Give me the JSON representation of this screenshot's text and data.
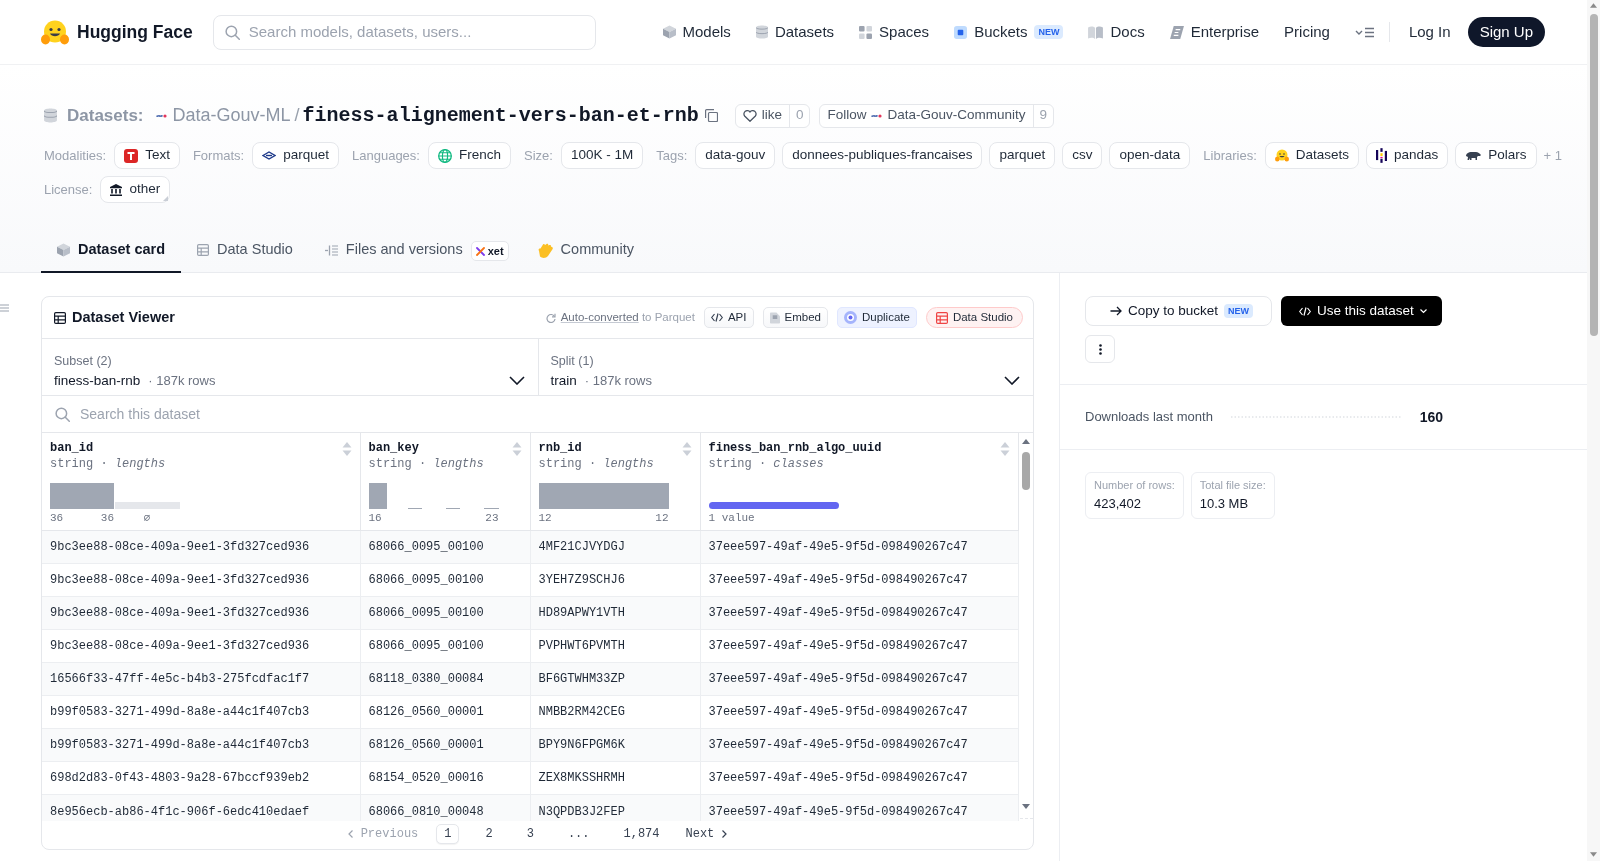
{
  "navbar": {
    "brand": "Hugging Face",
    "search": {
      "placeholder": "Search models, datasets, users..."
    },
    "links": [
      {
        "kind": "models",
        "label": "Models"
      },
      {
        "kind": "datasets",
        "label": "Datasets"
      },
      {
        "kind": "spaces",
        "label": "Spaces"
      },
      {
        "kind": "buckets",
        "label": "Buckets",
        "badge": "NEW"
      },
      {
        "kind": "docs",
        "label": "Docs"
      },
      {
        "kind": "enterprise",
        "label": "Enterprise"
      },
      {
        "kind": "plain",
        "label": "Pricing"
      }
    ],
    "login": "Log In",
    "signup": "Sign Up"
  },
  "repo": {
    "section": "Datasets:",
    "owner": "Data-Gouv-ML",
    "separator": "/",
    "name": "finess-alignement-vers-ban-et-rnb",
    "like": {
      "label": "like",
      "count": "0"
    },
    "follow": {
      "label": "Follow",
      "org": "Data-Gouv-Community",
      "count": "9"
    }
  },
  "metadata": [
    {
      "label": "Modalities:",
      "chips": [
        {
          "kind": "text",
          "text": "Text"
        }
      ]
    },
    {
      "label": "Formats:",
      "chips": [
        {
          "kind": "format",
          "text": "parquet"
        }
      ]
    },
    {
      "label": "Languages:",
      "chips": [
        {
          "kind": "language",
          "text": "French"
        }
      ]
    },
    {
      "label": "Size:",
      "chips": [
        {
          "kind": "plain",
          "text": "100K - 1M"
        }
      ]
    },
    {
      "label": "Tags:",
      "chips": [
        {
          "kind": "plain",
          "text": "data-gouv"
        },
        {
          "kind": "plain",
          "text": "donnees-publiques-francaises"
        },
        {
          "kind": "plain",
          "text": "parquet"
        },
        {
          "kind": "plain",
          "text": "csv"
        },
        {
          "kind": "plain",
          "text": "open-data"
        }
      ]
    },
    {
      "label": "Libraries:",
      "chips": [
        {
          "kind": "datasets",
          "text": "Datasets"
        },
        {
          "kind": "pandas",
          "text": "pandas"
        },
        {
          "kind": "polars",
          "text": "Polars"
        }
      ],
      "more": "+ 1"
    },
    {
      "label": "License:",
      "chips": [
        {
          "kind": "license",
          "text": "other"
        }
      ]
    }
  ],
  "tabs": [
    {
      "kind": "card",
      "label": "Dataset card",
      "selected": true
    },
    {
      "kind": "studio",
      "label": "Data Studio",
      "selected": false
    },
    {
      "kind": "files",
      "label": "Files and versions",
      "selected": false,
      "badge": "xet"
    },
    {
      "kind": "community",
      "label": "Community",
      "selected": false
    }
  ],
  "viewer": {
    "title": "Dataset Viewer",
    "conversion": {
      "link": "Auto-converted",
      "text": "to Parquet"
    },
    "actions": [
      {
        "kind": "api",
        "label": "API"
      },
      {
        "kind": "embed",
        "label": "Embed"
      },
      {
        "kind": "duplicate",
        "label": "Duplicate"
      },
      {
        "kind": "studio",
        "label": "Data Studio"
      }
    ],
    "subset": {
      "label": "Subset (2)",
      "value": "finess-ban-rnb",
      "detail": "· 187k rows"
    },
    "split": {
      "label": "Split (1)",
      "value": "train",
      "detail": "· 187k rows"
    },
    "search": {
      "placeholder": "Search this dataset"
    },
    "columns": [
      {
        "name": "ban_id",
        "type": "string · *lengths*",
        "kind": "histogram",
        "labels": [
          "36",
          "36",
          "∅"
        ]
      },
      {
        "name": "ban_key",
        "type": "string · *lengths*",
        "kind": "histogram",
        "labels": [
          "16",
          "23"
        ]
      },
      {
        "name": "rnb_id",
        "type": "string · *lengths*",
        "kind": "histogram",
        "labels": [
          "12",
          "12"
        ]
      },
      {
        "name": "finess_ban_rnb_algo_uuid",
        "type": "string · *classes*",
        "kind": "classes",
        "labels": [
          "1 value"
        ]
      }
    ],
    "rows": [
      [
        "9bc3ee88-08ce-409a-9ee1-3fd327ced936",
        "68066_0095_00100",
        "4MF21CJVYDGJ",
        "37eee597-49af-49e5-9f5d-098490267c47"
      ],
      [
        "9bc3ee88-08ce-409a-9ee1-3fd327ced936",
        "68066_0095_00100",
        "3YEH7Z9SCHJ6",
        "37eee597-49af-49e5-9f5d-098490267c47"
      ],
      [
        "9bc3ee88-08ce-409a-9ee1-3fd327ced936",
        "68066_0095_00100",
        "HD89APWY1VTH",
        "37eee597-49af-49e5-9f5d-098490267c47"
      ],
      [
        "9bc3ee88-08ce-409a-9ee1-3fd327ced936",
        "68066_0095_00100",
        "PVPHWT6PVMTH",
        "37eee597-49af-49e5-9f5d-098490267c47"
      ],
      [
        "16566f33-47ff-4e5c-b4b3-275fcdfac1f7",
        "68118_0380_00084",
        "BF6GTWHM33ZP",
        "37eee597-49af-49e5-9f5d-098490267c47"
      ],
      [
        "b99f0583-3271-499d-8a8e-a44c1f407cb3",
        "68126_0560_00001",
        "NMBB2RM42CEG",
        "37eee597-49af-49e5-9f5d-098490267c47"
      ],
      [
        "b99f0583-3271-499d-8a8e-a44c1f407cb3",
        "68126_0560_00001",
        "BPY9N6FPGM6K",
        "37eee597-49af-49e5-9f5d-098490267c47"
      ],
      [
        "698d2d83-0f43-4803-9a28-67bccf939eb2",
        "68154_0520_00016",
        "ZEX8MKSSHRMH",
        "37eee597-49af-49e5-9f5d-098490267c47"
      ],
      [
        "8e956ecb-ab86-4f1c-906f-6edc410edaef",
        "68066_0810_00048",
        "N3QPDB3J2FEP",
        "37eee597-49af-49e5-9f5d-098490267c47"
      ]
    ],
    "pagination": {
      "previous": {
        "label": "Previous",
        "disabled": true
      },
      "pages": [
        {
          "label": "1",
          "selected": true
        },
        {
          "label": "2",
          "selected": false
        },
        {
          "label": "3",
          "selected": false
        },
        {
          "label": "...",
          "selected": false
        },
        {
          "label": "1,874",
          "selected": false
        }
      ],
      "next": {
        "label": "Next",
        "disabled": false
      }
    }
  },
  "sidebar": {
    "copy": {
      "label": "Copy to bucket",
      "badge": "NEW"
    },
    "use": {
      "label": "Use this dataset"
    },
    "downloads": {
      "label": "Downloads last month",
      "value": "160"
    },
    "stats": [
      {
        "label": "Number of rows:",
        "value": "423,402"
      },
      {
        "label": "Total file size:",
        "value": "10.3 MB"
      }
    ]
  }
}
